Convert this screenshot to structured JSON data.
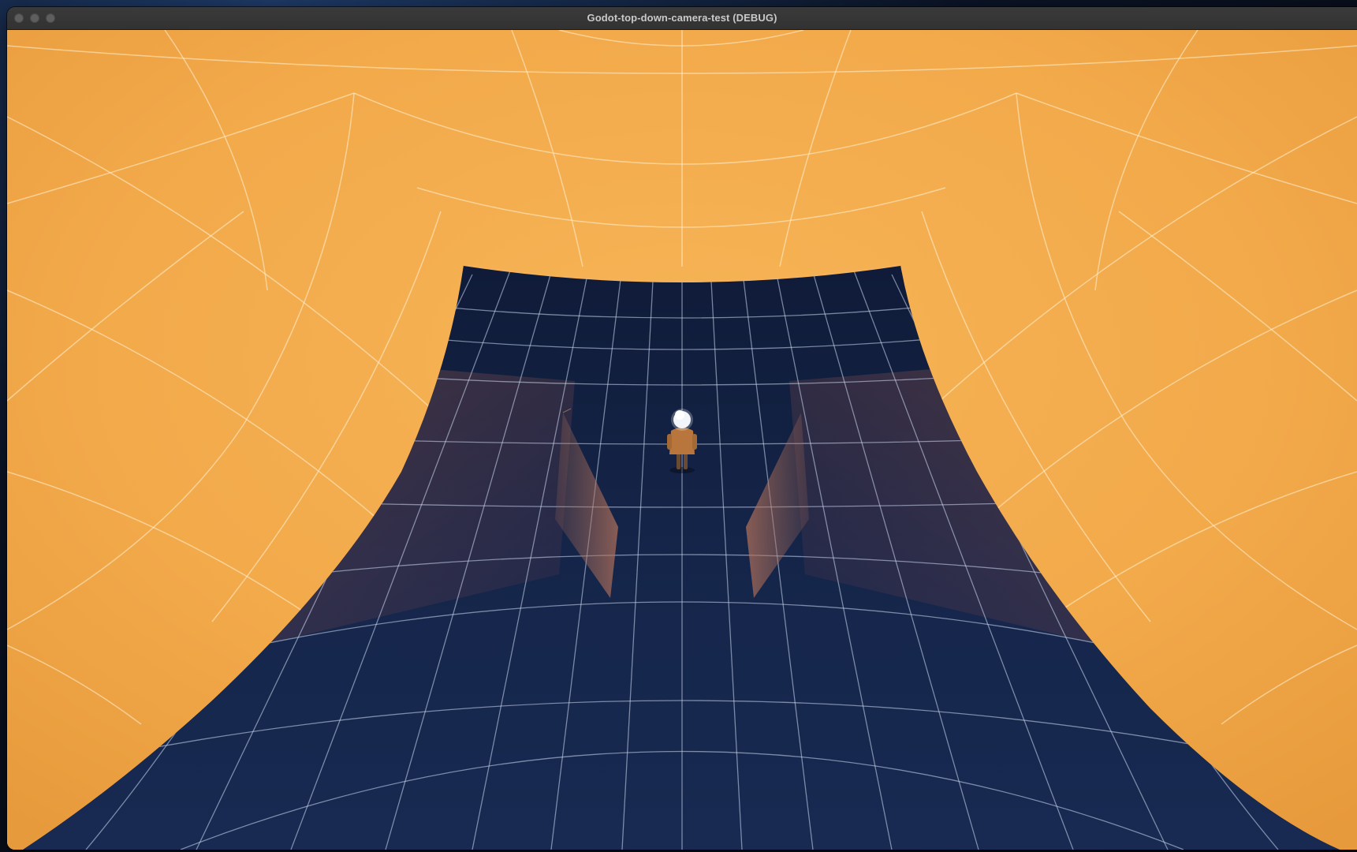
{
  "window": {
    "title": "Godot-top-down-camera-test (DEBUG)"
  },
  "titlebar": {
    "buttons": [
      "close",
      "minimize",
      "zoom"
    ]
  },
  "scene": {
    "wall_color": "#f2aa4c",
    "floor_color": "#142241",
    "grid_line_color": "#ffffff",
    "obstacle_color": "#8c5a52",
    "character_body_color": "#b8763c",
    "character_hair_color": "#eef2f7"
  }
}
